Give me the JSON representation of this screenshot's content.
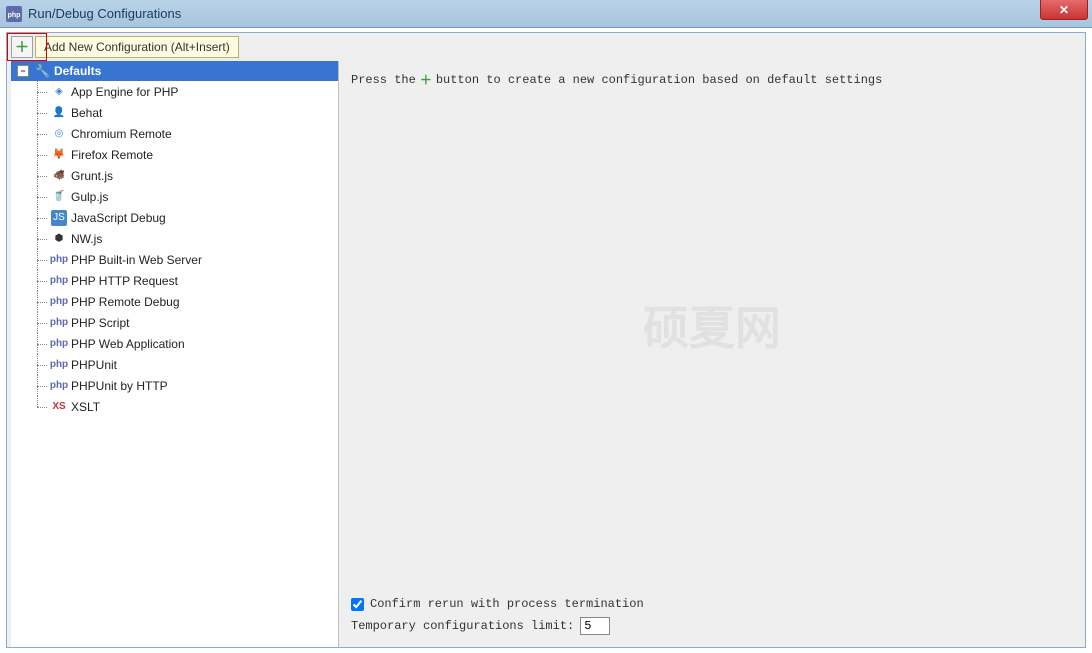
{
  "titlebar": {
    "title": "Run/Debug Configurations",
    "close_label": "✕"
  },
  "toolbar": {
    "tooltip": "Add New Configuration (Alt+Insert)"
  },
  "tree": {
    "root_label": "Defaults",
    "items": [
      {
        "label": "App Engine for PHP",
        "icon": "app-engine-icon",
        "iconCls": "ic-ae",
        "glyph": "◈"
      },
      {
        "label": "Behat",
        "icon": "behat-icon",
        "iconCls": "ic-behat",
        "glyph": "👤"
      },
      {
        "label": "Chromium Remote",
        "icon": "chromium-icon",
        "iconCls": "ic-chrome",
        "glyph": "◎"
      },
      {
        "label": "Firefox Remote",
        "icon": "firefox-icon",
        "iconCls": "ic-ff",
        "glyph": "🦊"
      },
      {
        "label": "Grunt.js",
        "icon": "grunt-icon",
        "iconCls": "ic-grunt",
        "glyph": "🐗"
      },
      {
        "label": "Gulp.js",
        "icon": "gulp-icon",
        "iconCls": "ic-gulp",
        "glyph": "🥤"
      },
      {
        "label": "JavaScript Debug",
        "icon": "js-debug-icon",
        "iconCls": "ic-js",
        "glyph": "JS"
      },
      {
        "label": "NW.js",
        "icon": "nwjs-icon",
        "iconCls": "ic-nw",
        "glyph": "⬢"
      },
      {
        "label": "PHP Built-in Web Server",
        "icon": "php-server-icon",
        "iconCls": "ic-php",
        "glyph": "php"
      },
      {
        "label": "PHP HTTP Request",
        "icon": "php-http-icon",
        "iconCls": "ic-php",
        "glyph": "php"
      },
      {
        "label": "PHP Remote Debug",
        "icon": "php-remote-icon",
        "iconCls": "ic-php",
        "glyph": "php"
      },
      {
        "label": "PHP Script",
        "icon": "php-script-icon",
        "iconCls": "ic-php",
        "glyph": "php"
      },
      {
        "label": "PHP Web Application",
        "icon": "php-web-icon",
        "iconCls": "ic-php",
        "glyph": "php"
      },
      {
        "label": "PHPUnit",
        "icon": "phpunit-icon",
        "iconCls": "ic-php",
        "glyph": "php"
      },
      {
        "label": "PHPUnit by HTTP",
        "icon": "phpunit-http-icon",
        "iconCls": "ic-php",
        "glyph": "php"
      },
      {
        "label": "XSLT",
        "icon": "xslt-icon",
        "iconCls": "ic-xslt",
        "glyph": "XS"
      }
    ]
  },
  "right": {
    "hint_pre": "Press the",
    "hint_post": "button to create a new configuration based on default settings",
    "confirm_label": "Confirm rerun with process termination",
    "confirm_checked": true,
    "temp_limit_label": "Temporary configurations limit:",
    "temp_limit_value": "5",
    "watermark": "硕夏网"
  }
}
